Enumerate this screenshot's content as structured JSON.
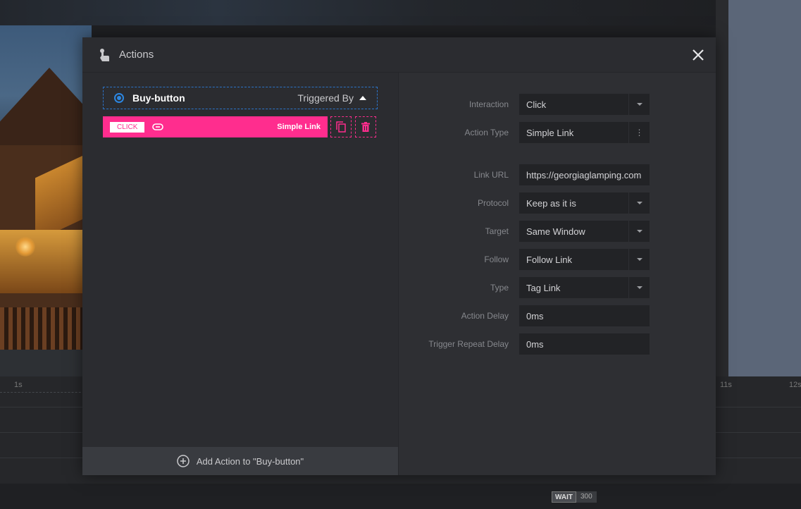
{
  "modal": {
    "title": "Actions",
    "layer": {
      "name": "Buy-button",
      "triggered_label": "Triggered By"
    },
    "action": {
      "event_chip": "CLICK",
      "type_label": "Simple Link"
    },
    "add_action_label": "Add Action to \"Buy-button\""
  },
  "settings": {
    "interaction": {
      "label": "Interaction",
      "value": "Click"
    },
    "action_type": {
      "label": "Action Type",
      "value": "Simple Link"
    },
    "link_url": {
      "label": "Link URL",
      "value": "https://georgiaglamping.com"
    },
    "protocol": {
      "label": "Protocol",
      "value": "Keep as it is"
    },
    "target": {
      "label": "Target",
      "value": "Same Window"
    },
    "follow": {
      "label": "Follow",
      "value": "Follow Link"
    },
    "type": {
      "label": "Type",
      "value": "Tag Link"
    },
    "action_delay": {
      "label": "Action Delay",
      "value": "0ms"
    },
    "trigger_repeat_delay": {
      "label": "Trigger Repeat Delay",
      "value": "0ms"
    }
  },
  "timeline": {
    "ticks": [
      "1s",
      "11s",
      "12s"
    ],
    "wait_label": "WAIT",
    "wait_value": "300"
  },
  "colors": {
    "accent_pink": "#ff2d8e",
    "accent_blue": "#2c86e0",
    "modal_bg": "#2b2c30"
  }
}
